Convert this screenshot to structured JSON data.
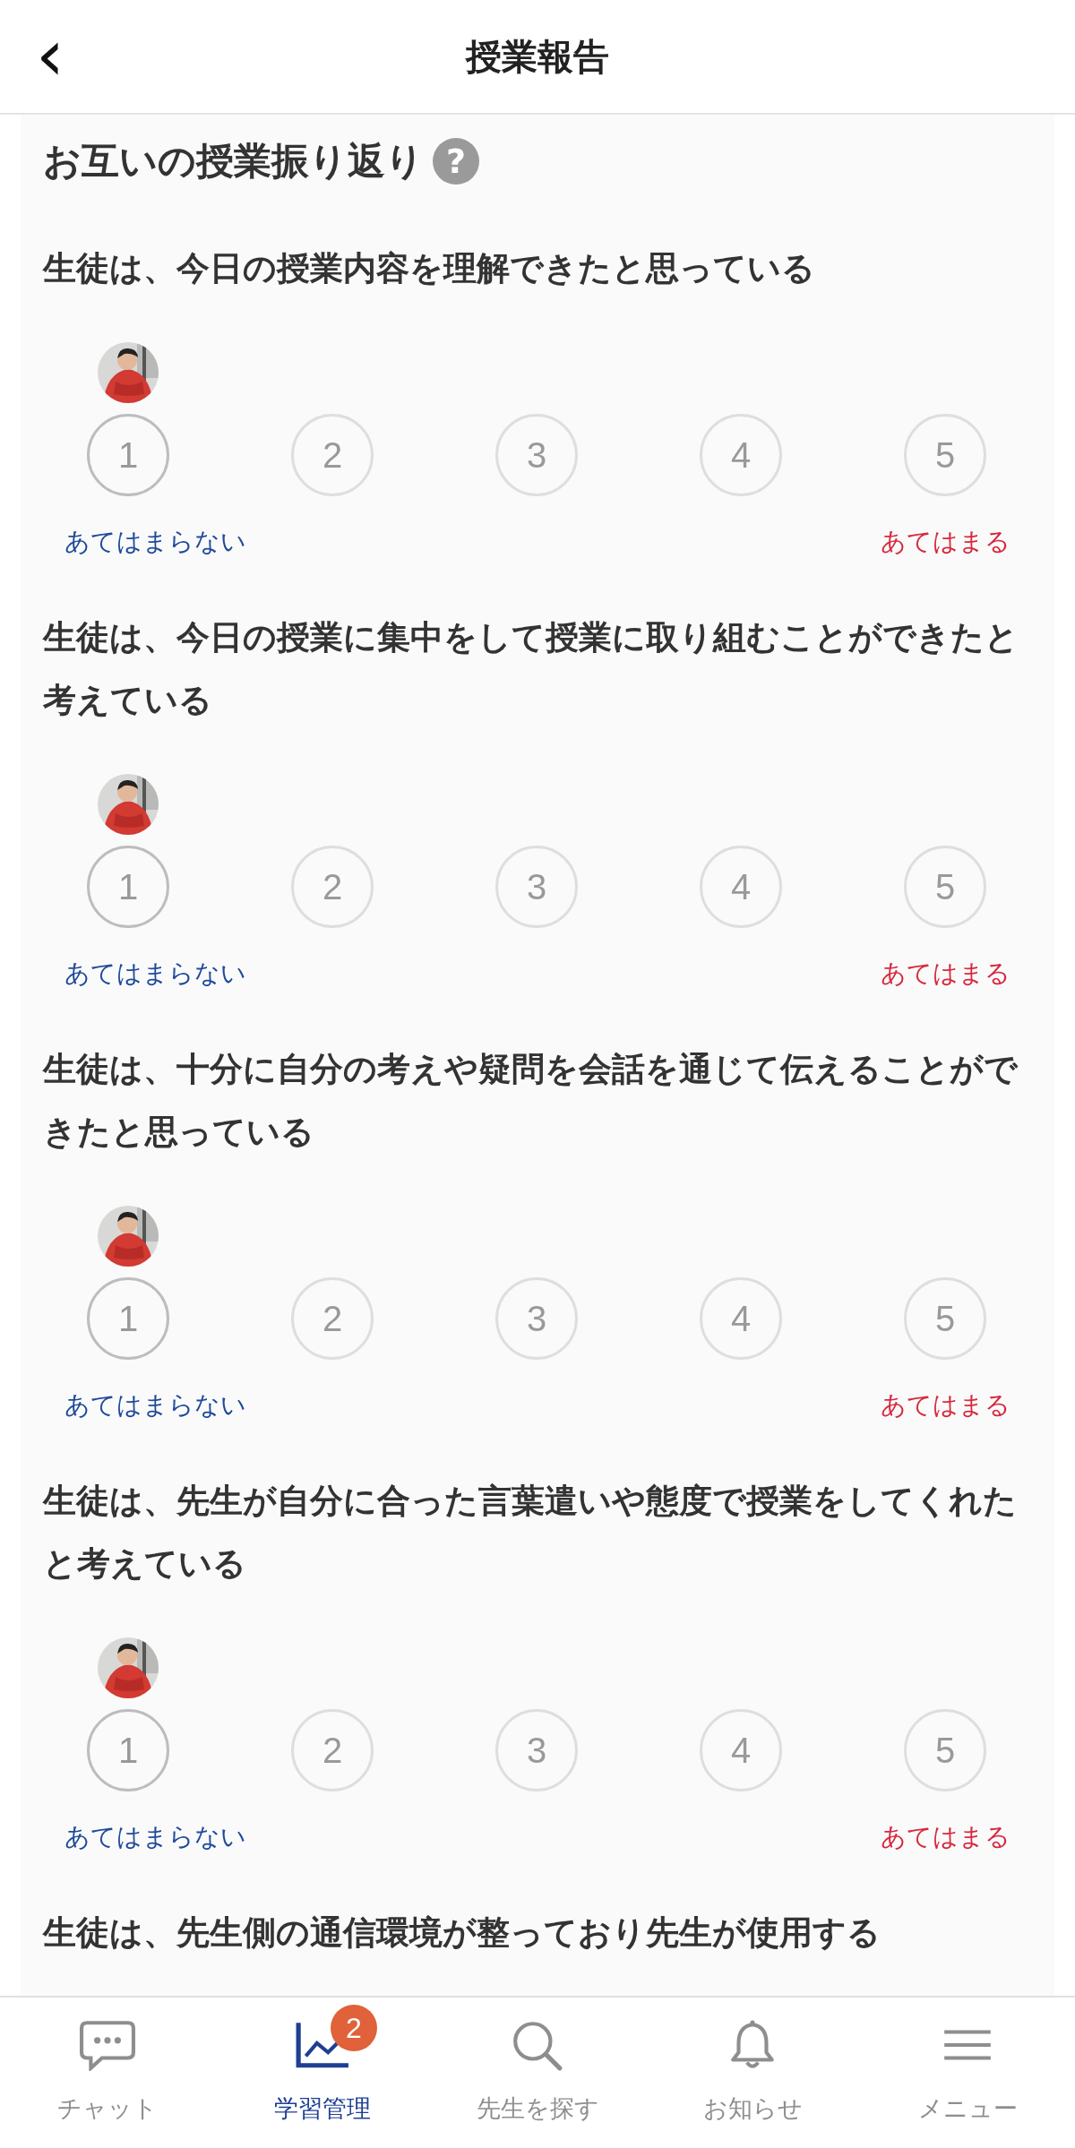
{
  "header": {
    "back_icon": "‹",
    "title": "授業報告"
  },
  "section": {
    "title": "お互いの授業振り返り",
    "help_icon": "?"
  },
  "questions": [
    {
      "text": "生徒は、今日の授業内容を理解できたと思っている",
      "options": [
        {
          "label": "1",
          "selected": true
        },
        {
          "label": "2",
          "selected": false
        },
        {
          "label": "3",
          "selected": false
        },
        {
          "label": "4",
          "selected": false
        },
        {
          "label": "5",
          "selected": false
        }
      ],
      "low_label": "あてはまらない",
      "high_label": "あてはまる"
    },
    {
      "text": "生徒は、今日の授業に集中をして授業に取り組むことができたと考えている",
      "options": [
        {
          "label": "1",
          "selected": true
        },
        {
          "label": "2",
          "selected": false
        },
        {
          "label": "3",
          "selected": false
        },
        {
          "label": "4",
          "selected": false
        },
        {
          "label": "5",
          "selected": false
        }
      ],
      "low_label": "あてはまらない",
      "high_label": "あてはまる"
    },
    {
      "text": "生徒は、十分に自分の考えや疑問を会話を通じて伝えることができたと思っている",
      "options": [
        {
          "label": "1",
          "selected": true
        },
        {
          "label": "2",
          "selected": false
        },
        {
          "label": "3",
          "selected": false
        },
        {
          "label": "4",
          "selected": false
        },
        {
          "label": "5",
          "selected": false
        }
      ],
      "low_label": "あてはまらない",
      "high_label": "あてはまる"
    },
    {
      "text": "生徒は、先生が自分に合った言葉遣いや態度で授業をしてくれたと考えている",
      "options": [
        {
          "label": "1",
          "selected": true
        },
        {
          "label": "2",
          "selected": false
        },
        {
          "label": "3",
          "selected": false
        },
        {
          "label": "4",
          "selected": false
        },
        {
          "label": "5",
          "selected": false
        }
      ],
      "low_label": "あてはまらない",
      "high_label": "あてはまる"
    },
    {
      "text": "生徒は、先生側の通信環境が整っており先生が使用する"
    }
  ],
  "tab_bar": [
    {
      "kind": "chat",
      "label": "チャット",
      "selected": false
    },
    {
      "kind": "chart",
      "label": "学習管理",
      "selected": true,
      "badge": "2"
    },
    {
      "kind": "search",
      "label": "先生を探す",
      "selected": false
    },
    {
      "kind": "bell",
      "label": "お知らせ",
      "selected": false
    },
    {
      "kind": "menu",
      "label": "メニュー",
      "selected": false
    }
  ]
}
